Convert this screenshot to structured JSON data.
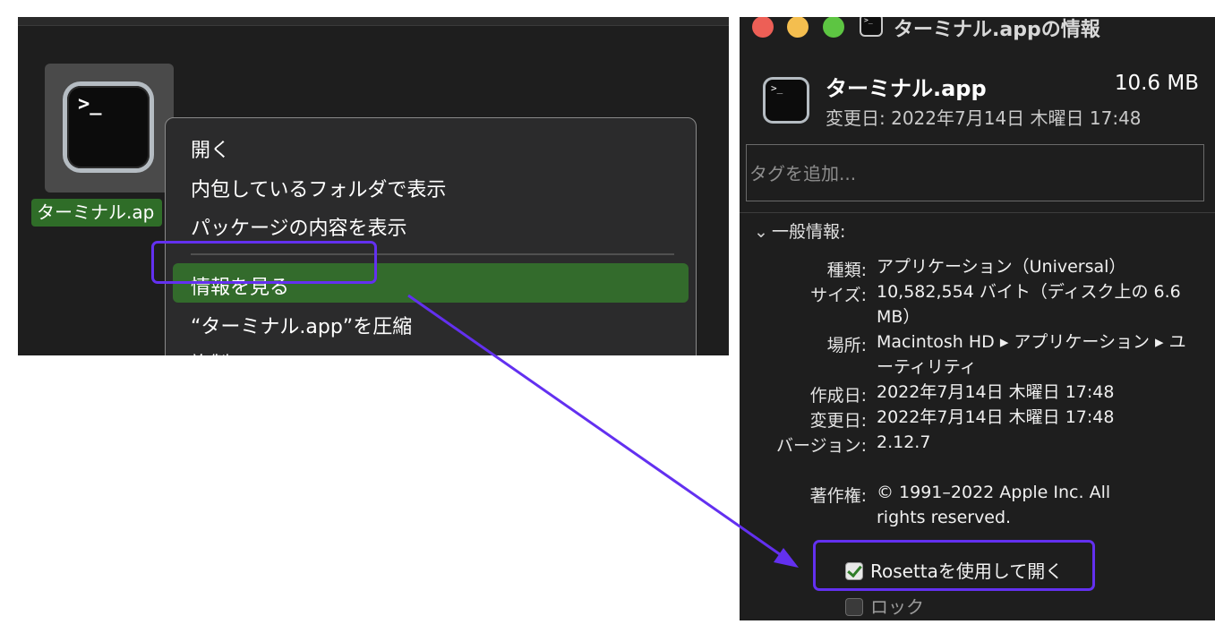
{
  "finder": {
    "file_label": "ターミナル.ap",
    "icon_prompt": ">_",
    "context_menu": {
      "items": [
        "開く",
        "内包しているフォルダで表示",
        "パッケージの内容を表示",
        "情報を見る",
        "“ターミナル.app”を圧縮",
        "複製"
      ],
      "highlighted_index": 3
    }
  },
  "info_window": {
    "title": "ターミナル.appの情報",
    "icon_prompt": ">_",
    "name": "ターミナル.app",
    "size": "10.6 MB",
    "modified_line": "変更日: 2022年7月14日 木曜日 17:48",
    "tag_placeholder": "タグを追加...",
    "section_title": "一般情報:",
    "rows": [
      {
        "label": "種類:",
        "value": "アプリケーション（Universal）"
      },
      {
        "label": "サイズ:",
        "value": "10,582,554 バイト（ディスク上の 6.6 MB）"
      },
      {
        "label": "場所:",
        "value": "Macintosh HD ▸ アプリケーション ▸ ユーティリティ"
      },
      {
        "label": "作成日:",
        "value": "2022年7月14日 木曜日 17:48"
      },
      {
        "label": "変更日:",
        "value": "2022年7月14日 木曜日 17:48"
      },
      {
        "label": "バージョン:",
        "value": "2.12.7"
      },
      {
        "label": "著作権:",
        "value": "© 1991–2022 Apple Inc. All rights reserved."
      }
    ],
    "rosetta_label": "Rosettaを使用して開く",
    "rosetta_checked": true,
    "lock_label": "ロック",
    "lock_checked": false
  },
  "colors": {
    "callout": "#6330f0",
    "selection_green": "#336b2c",
    "window_bg": "#1e1e1e"
  }
}
